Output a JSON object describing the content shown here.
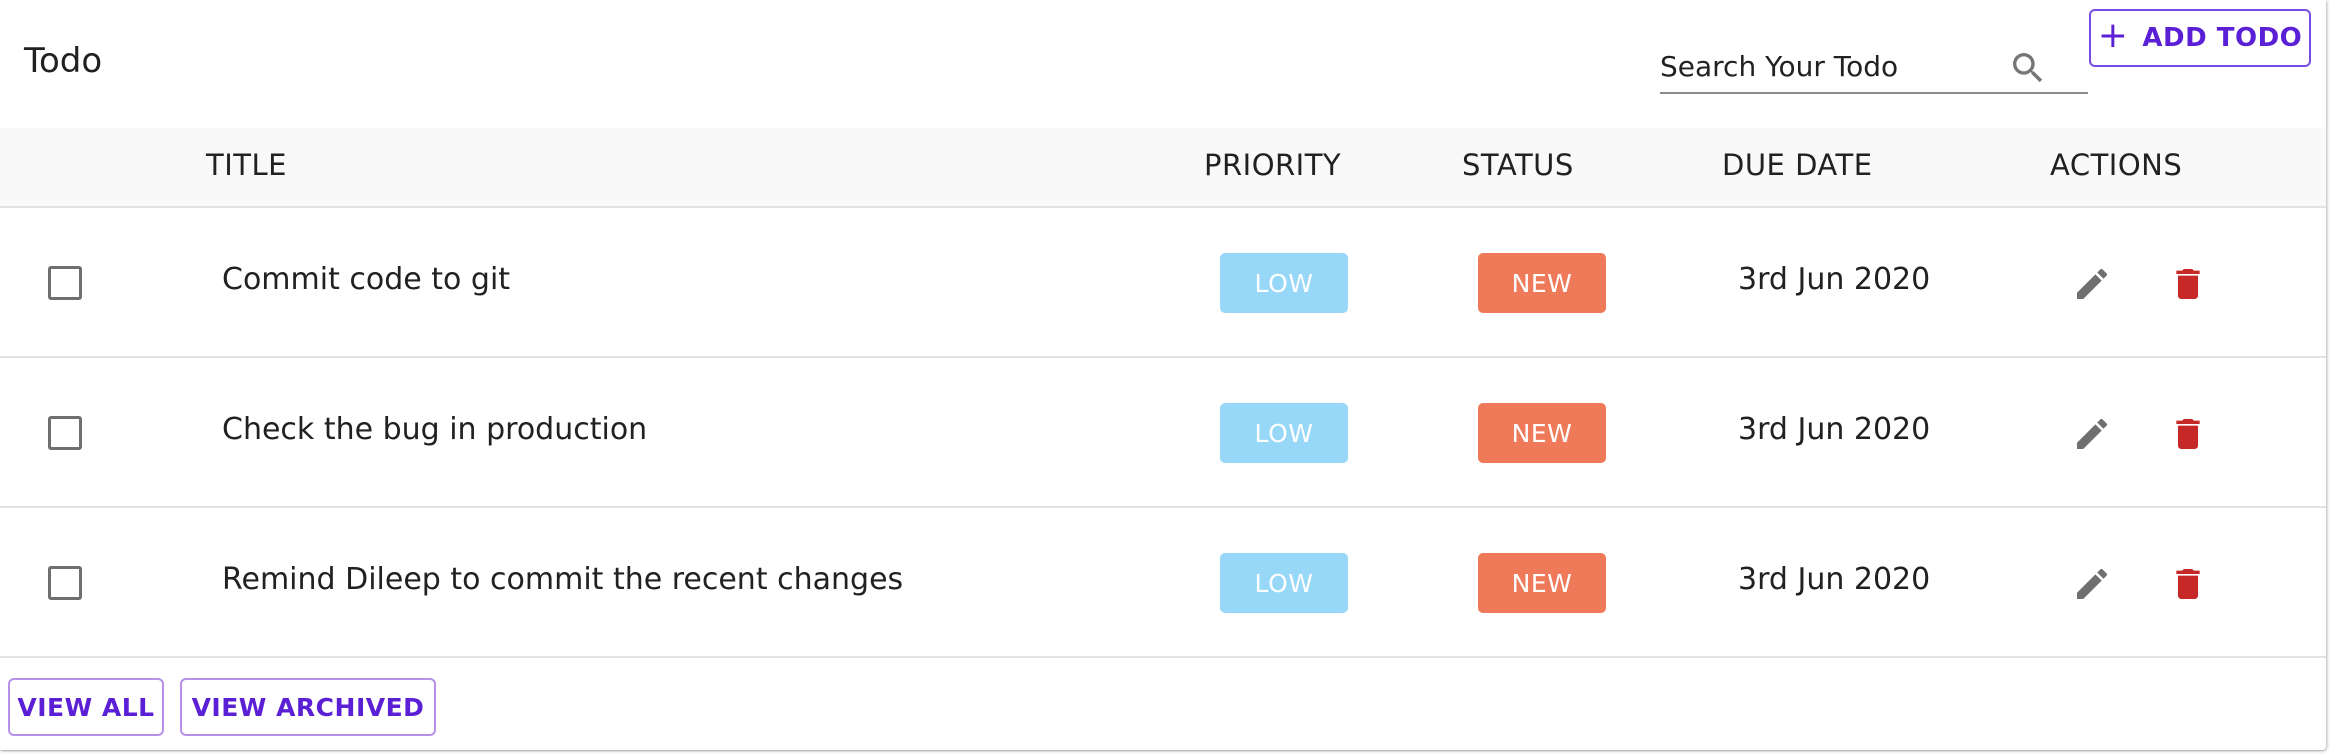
{
  "header": {
    "title": "Todo",
    "search_placeholder": "Search Your Todo",
    "search_value": "",
    "add_button_label": "ADD TODO"
  },
  "table": {
    "columns": {
      "title": "TITLE",
      "priority": "PRIORITY",
      "status": "STATUS",
      "due_date": "DUE DATE",
      "actions": "ACTIONS"
    },
    "rows": [
      {
        "checked": false,
        "title": "Commit code to git",
        "priority": "LOW",
        "status": "NEW",
        "due_date": "3rd Jun 2020"
      },
      {
        "checked": false,
        "title": "Check the bug in production",
        "priority": "LOW",
        "status": "NEW",
        "due_date": "3rd Jun 2020"
      },
      {
        "checked": false,
        "title": "Remind Dileep to commit the recent changes",
        "priority": "LOW",
        "status": "NEW",
        "due_date": "3rd Jun 2020"
      }
    ]
  },
  "footer": {
    "view_all_label": "VIEW ALL",
    "view_archived_label": "VIEW ARCHIVED"
  },
  "icons": {
    "add": "plus-icon",
    "search": "search-icon",
    "edit": "pencil-icon",
    "delete": "trash-icon"
  },
  "colors": {
    "accent": "#5b1fd6",
    "priority_low": "#97d7f7",
    "status_new": "#ee7a59",
    "delete": "#c62828",
    "edit": "#6f6f6f"
  }
}
